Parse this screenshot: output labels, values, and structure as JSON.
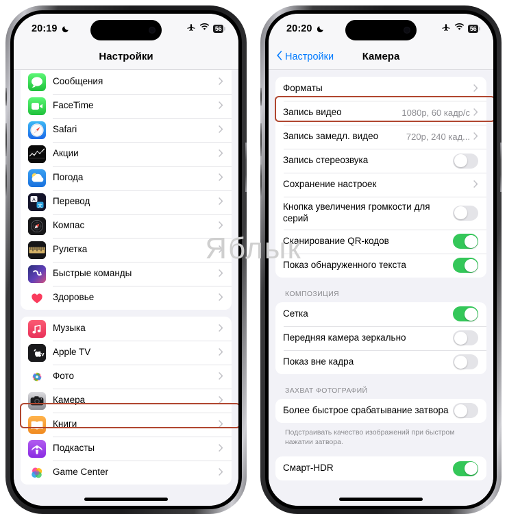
{
  "watermark": "Яблык",
  "accent": {
    "highlight_box": "#b0462f",
    "toggle_on": "#34c759",
    "link_blue": "#007aff"
  },
  "left_phone": {
    "status": {
      "time": "20:19",
      "dnd_icon": "moon-icon",
      "airplane_icon": "airplane-icon",
      "wifi_icon": "wifi-icon",
      "battery": "56"
    },
    "nav": {
      "title": "Настройки"
    },
    "group_one": [
      {
        "label": "Сообщения",
        "icon": "messages-icon",
        "accessory": "chevron"
      },
      {
        "label": "FaceTime",
        "icon": "facetime-icon",
        "accessory": "chevron"
      },
      {
        "label": "Safari",
        "icon": "safari-icon",
        "accessory": "chevron"
      },
      {
        "label": "Акции",
        "icon": "stocks-icon",
        "accessory": "chevron"
      },
      {
        "label": "Погода",
        "icon": "weather-icon",
        "accessory": "chevron"
      },
      {
        "label": "Перевод",
        "icon": "translate-icon",
        "accessory": "chevron"
      },
      {
        "label": "Компас",
        "icon": "compass-icon",
        "accessory": "chevron"
      },
      {
        "label": "Рулетка",
        "icon": "measure-icon",
        "accessory": "chevron"
      },
      {
        "label": "Быстрые команды",
        "icon": "shortcuts-icon",
        "accessory": "chevron"
      },
      {
        "label": "Здоровье",
        "icon": "health-icon",
        "accessory": "chevron"
      }
    ],
    "group_two": [
      {
        "label": "Музыка",
        "icon": "music-icon",
        "accessory": "chevron"
      },
      {
        "label": "Apple TV",
        "icon": "appletv-icon",
        "accessory": "chevron"
      },
      {
        "label": "Фото",
        "icon": "photos-icon",
        "accessory": "chevron"
      },
      {
        "label": "Камера",
        "icon": "camera-icon",
        "accessory": "chevron",
        "highlighted": true
      },
      {
        "label": "Книги",
        "icon": "books-icon",
        "accessory": "chevron"
      },
      {
        "label": "Подкасты",
        "icon": "podcasts-icon",
        "accessory": "chevron"
      },
      {
        "label": "Game Center",
        "icon": "gamecenter-icon",
        "accessory": "chevron"
      }
    ]
  },
  "right_phone": {
    "status": {
      "time": "20:20",
      "dnd_icon": "moon-icon",
      "airplane_icon": "airplane-icon",
      "wifi_icon": "wifi-icon",
      "battery": "56"
    },
    "nav": {
      "back_label": "Настройки",
      "title": "Камера"
    },
    "group_one": [
      {
        "label": "Форматы",
        "accessory": "chevron"
      },
      {
        "label": "Запись видео",
        "value": "1080p, 60 кадр/с",
        "accessory": "chevron",
        "highlighted": true
      },
      {
        "label": "Запись замедл. видео",
        "value": "720p, 240 кад...",
        "accessory": "chevron"
      },
      {
        "label": "Запись стереозвука",
        "accessory": "toggle",
        "on": false
      },
      {
        "label": "Сохранение настроек",
        "accessory": "chevron"
      },
      {
        "label": "Кнопка увеличения громкости для серий",
        "accessory": "toggle",
        "on": false
      },
      {
        "label": "Сканирование QR-кодов",
        "accessory": "toggle",
        "on": true
      },
      {
        "label": "Показ обнаруженного текста",
        "accessory": "toggle",
        "on": true
      }
    ],
    "section_composition": "КОМПОЗИЦИЯ",
    "group_composition": [
      {
        "label": "Сетка",
        "accessory": "toggle",
        "on": true
      },
      {
        "label": "Передняя камера зеркально",
        "accessory": "toggle",
        "on": false
      },
      {
        "label": "Показ вне кадра",
        "accessory": "toggle",
        "on": false
      }
    ],
    "section_capture": "ЗАХВАТ ФОТОГРАФИЙ",
    "group_capture": [
      {
        "label": "Более быстрое срабатывание затвора",
        "accessory": "toggle",
        "on": false
      }
    ],
    "capture_footnote": "Подстраивать качество изображений при быстром нажатии затвора.",
    "group_hdr": [
      {
        "label": "Смарт-HDR",
        "accessory": "toggle",
        "on": true
      }
    ]
  }
}
